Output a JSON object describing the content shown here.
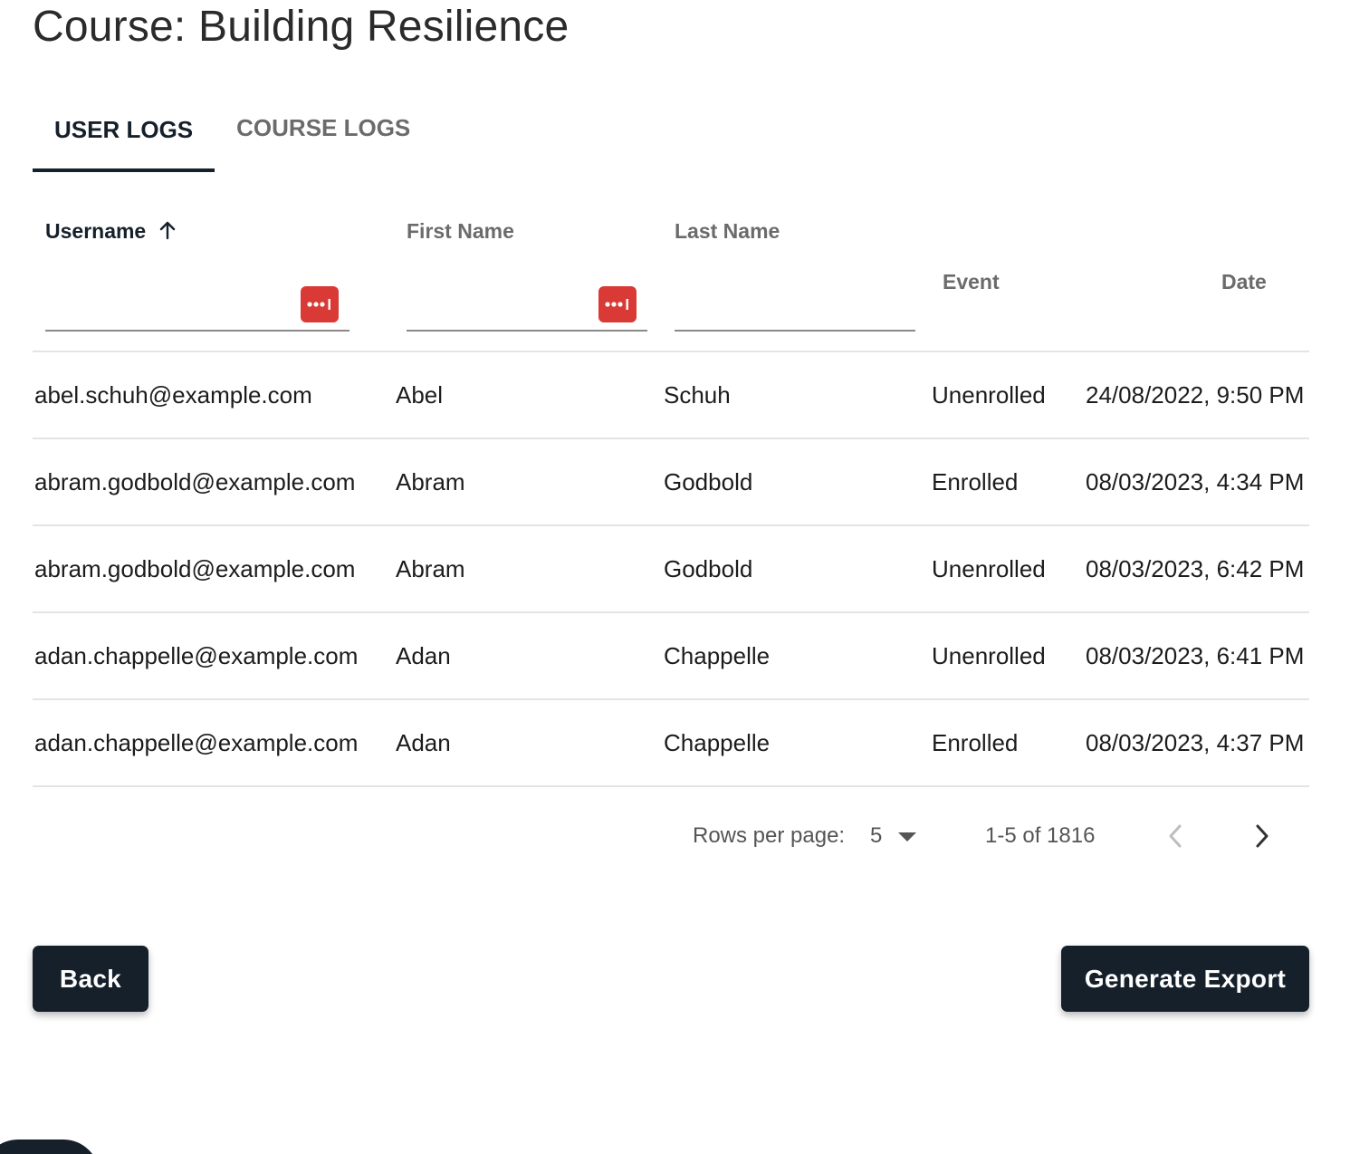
{
  "page": {
    "title": "Course: Building Resilience"
  },
  "tabs": [
    {
      "label": "USER LOGS",
      "active": true
    },
    {
      "label": "COURSE LOGS",
      "active": false
    }
  ],
  "table": {
    "columns": [
      {
        "key": "username",
        "label": "Username",
        "sorted": "ascending",
        "filterable": true
      },
      {
        "key": "first_name",
        "label": "First Name",
        "filterable": true
      },
      {
        "key": "last_name",
        "label": "Last Name",
        "filterable": true
      },
      {
        "key": "event",
        "label": "Event",
        "filterable": false
      },
      {
        "key": "date",
        "label": "Date",
        "filterable": false
      }
    ],
    "filters": {
      "username": "",
      "first_name": "",
      "last_name": ""
    },
    "rows": [
      {
        "username": "abel.schuh@example.com",
        "first_name": "Abel",
        "last_name": "Schuh",
        "event": "Unenrolled",
        "date": "24/08/2022, 9:50 PM"
      },
      {
        "username": "abram.godbold@example.com",
        "first_name": "Abram",
        "last_name": "Godbold",
        "event": "Enrolled",
        "date": "08/03/2023, 4:34 PM"
      },
      {
        "username": "abram.godbold@example.com",
        "first_name": "Abram",
        "last_name": "Godbold",
        "event": "Unenrolled",
        "date": "08/03/2023, 6:42 PM"
      },
      {
        "username": "adan.chappelle@example.com",
        "first_name": "Adan",
        "last_name": "Chappelle",
        "event": "Unenrolled",
        "date": "08/03/2023, 6:41 PM"
      },
      {
        "username": "adan.chappelle@example.com",
        "first_name": "Adan",
        "last_name": "Chappelle",
        "event": "Enrolled",
        "date": "08/03/2023, 4:37 PM"
      }
    ]
  },
  "pagination": {
    "rows_per_page_label": "Rows per page:",
    "rows_per_page": "5",
    "range": "1-5 of 1816"
  },
  "actions": {
    "back_label": "Back",
    "export_label": "Generate Export"
  },
  "icons": {
    "sort": "arrow-up-icon",
    "password_manager": "password-manager-icon",
    "dropdown": "caret-down-icon",
    "prev": "chevron-left-icon",
    "next": "chevron-right-icon"
  },
  "colors": {
    "primary": "#15202b",
    "password_manager": "#d93a36",
    "muted_text": "#6b6b6b",
    "divider": "#e4e4e4"
  }
}
